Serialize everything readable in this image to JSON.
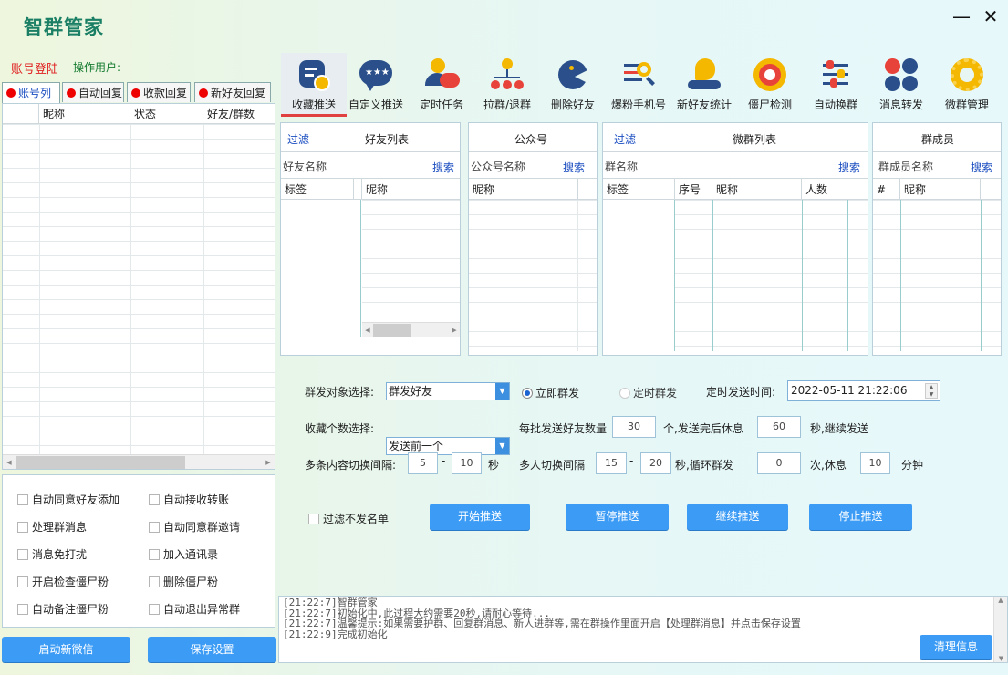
{
  "app": {
    "title": "智群管家",
    "minimize": "—",
    "close": "✕"
  },
  "account": {
    "login": "账号登陆",
    "operator": "操作用户:"
  },
  "left_tabs": [
    "账号列",
    "自动回复",
    "收款回复",
    "新好友回复"
  ],
  "account_table": {
    "columns": [
      "",
      "昵称",
      "状态",
      "好友/群数"
    ]
  },
  "options": {
    "left": [
      "自动同意好友添加",
      "处理群消息",
      "消息免打扰",
      "开启检查僵尸粉",
      "自动备注僵尸粉"
    ],
    "right": [
      "自动接收转账",
      "自动同意群邀请",
      "加入通讯录",
      "删除僵尸粉",
      "自动退出异常群"
    ]
  },
  "buttons": {
    "start_wechat": "启动新微信",
    "save_settings": "保存设置"
  },
  "toolbar": [
    {
      "label": "收藏推送",
      "icon": "favorite-push-icon"
    },
    {
      "label": "自定义推送",
      "icon": "custom-push-icon"
    },
    {
      "label": "定时任务",
      "icon": "scheduled-task-icon"
    },
    {
      "label": "拉群/退群",
      "icon": "group-join-icon"
    },
    {
      "label": "删除好友",
      "icon": "delete-friend-icon"
    },
    {
      "label": "爆粉手机号",
      "icon": "phone-search-icon"
    },
    {
      "label": "新好友统计",
      "icon": "friend-stats-icon"
    },
    {
      "label": "僵尸检测",
      "icon": "zombie-detect-icon"
    },
    {
      "label": "自动换群",
      "icon": "auto-switch-group-icon"
    },
    {
      "label": "消息转发",
      "icon": "message-forward-icon"
    },
    {
      "label": "微群管理",
      "icon": "group-manage-icon"
    }
  ],
  "friends": {
    "filter": "过滤",
    "title": "好友列表",
    "name_label": "好友名称",
    "search": "搜索",
    "columns": [
      "标签",
      "昵称"
    ]
  },
  "official": {
    "title": "公众号",
    "name_label": "公众号名称",
    "search": "搜索",
    "columns": [
      "昵称"
    ]
  },
  "groups": {
    "filter": "过滤",
    "title": "微群列表",
    "name_label": "群名称",
    "search": "搜索",
    "columns": [
      "标签",
      "序号",
      "昵称",
      "人数"
    ]
  },
  "members": {
    "title": "群成员",
    "name_label": "群成员名称",
    "search": "搜索",
    "columns": [
      "#",
      "昵称"
    ]
  },
  "form": {
    "target_label": "群发对象选择:",
    "target_value": "群发好友",
    "radio_now": "立即群发",
    "radio_timed": "定时群发",
    "time_label": "定时发送时间:",
    "time_value": "2022-05-11 21:22:06",
    "fav_label": "收藏个数选择:",
    "fav_value": "发送前一个",
    "batch_label": "每批发送好友数量",
    "batch_value": "30",
    "rest_label": "个,发送完后休息",
    "rest_value": "60",
    "continue_label": "秒,继续发送",
    "content_label": "多条内容切换间隔:",
    "content_min": "5",
    "content_dash": "-",
    "content_max": "10",
    "sec": "秒",
    "multi_label": "多人切换间隔",
    "multi_min": "15",
    "multi_dash": "-",
    "multi_max": "20",
    "loop_label": "秒,循环群发",
    "loop_value": "0",
    "times_label": "次,休息",
    "rest_min": "10",
    "minutes": "分钟",
    "filter_label": "过滤不发名单"
  },
  "actions": {
    "start": "开始推送",
    "pause": "暂停推送",
    "resume": "继续推送",
    "stop": "停止推送"
  },
  "log": [
    "[21:22:7]智群管家",
    "[21:22:7]初始化中,此过程大约需要20秒,请耐心等待...",
    "[21:22:7]温馨提示:如果需要护群、回复群消息、新人进群等,需在群操作里面开启【处理群消息】并点击保存设置",
    "[21:22:9]完成初始化"
  ],
  "clear": "清理信息"
}
